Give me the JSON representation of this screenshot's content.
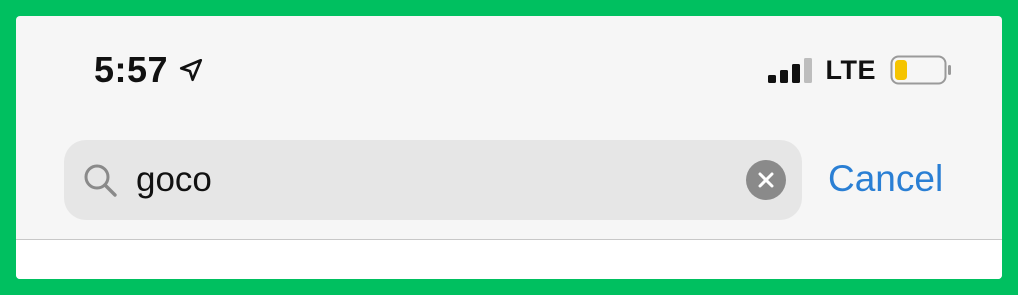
{
  "status_bar": {
    "time": "5:57",
    "location_icon": "location-arrow-icon",
    "signal_icon": "cellular-signal-icon",
    "signal_bars_active": 3,
    "signal_bars_total": 4,
    "network": "LTE",
    "battery_icon": "battery-low-icon",
    "battery_level": 0.2,
    "battery_color": "#f5c400"
  },
  "search": {
    "icon": "search-icon",
    "value": "goco",
    "clear_icon": "clear-icon"
  },
  "actions": {
    "cancel_label": "Cancel"
  },
  "colors": {
    "frame_border": "#00c060",
    "background": "#f6f6f6",
    "search_field": "#e6e6e6",
    "accent": "#2a7fd4"
  }
}
